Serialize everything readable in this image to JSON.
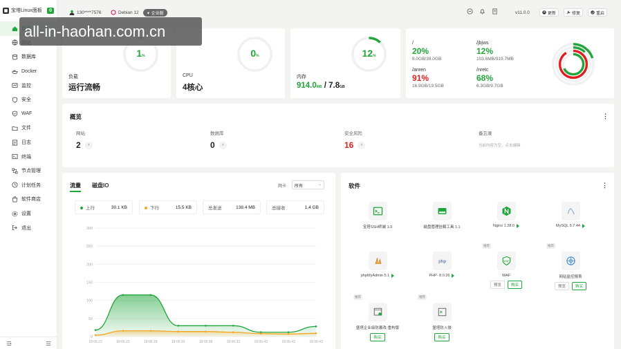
{
  "brand": {
    "name": "宝塔Linux面板",
    "badge": "0"
  },
  "nav": [
    {
      "label": "首页",
      "icon": "home-icon"
    },
    {
      "label": "网站",
      "icon": "globe-icon"
    },
    {
      "label": "数据库",
      "icon": "database-icon"
    },
    {
      "label": "Docker",
      "icon": "docker-icon"
    },
    {
      "label": "监控",
      "icon": "monitor-icon"
    },
    {
      "label": "安全",
      "icon": "shield-icon"
    },
    {
      "label": "WAF",
      "icon": "waf-icon"
    },
    {
      "label": "文件",
      "icon": "folder-icon"
    },
    {
      "label": "日志",
      "icon": "log-icon"
    },
    {
      "label": "终端",
      "icon": "terminal-icon"
    },
    {
      "label": "节点管理",
      "icon": "node-icon"
    },
    {
      "label": "计划任务",
      "icon": "clock-icon"
    },
    {
      "label": "软件商店",
      "icon": "store-icon"
    },
    {
      "label": "设置",
      "icon": "gear-icon"
    },
    {
      "label": "退出",
      "icon": "logout-icon"
    }
  ],
  "header": {
    "user": "130****7576",
    "os": "Debian 12",
    "edition": "企业版",
    "version": "v11.0.0",
    "update": "更新",
    "repair": "修复",
    "restart": "重启"
  },
  "stats": {
    "load": {
      "percent": 1,
      "unit": "%",
      "label": "负载",
      "value": "运行流畅"
    },
    "cpu": {
      "percent": 0,
      "unit": "%",
      "label": "CPU",
      "value": "4核心"
    },
    "memory": {
      "percent": 12,
      "unit": "%",
      "label": "内存",
      "used": "914.0",
      "used_unit": "MB",
      "sep": " / ",
      "total": "7.8",
      "total_unit": "GB"
    }
  },
  "disks": [
    {
      "path": "/",
      "percent": "20%",
      "size": "8.0GB/39.0GB",
      "status": "ok",
      "fraction": 0.2
    },
    {
      "path": "/jbjws",
      "percent": "12%",
      "size": "103.6MB/919.7MB",
      "status": "ok",
      "fraction": 0.12
    },
    {
      "path": "/anren",
      "percent": "91%",
      "size": "16.9GB/19.5GB",
      "status": "danger",
      "fraction": 0.91
    },
    {
      "path": "/nretc",
      "percent": "68%",
      "size": "6.3GB/9.7GB",
      "status": "ok",
      "fraction": 0.68
    }
  ],
  "overview": {
    "title": "概览",
    "items": [
      {
        "label": "网站",
        "value": "2"
      },
      {
        "label": "数据库",
        "value": "0"
      },
      {
        "label": "安全风险",
        "value": "16"
      },
      {
        "label": "备忘录",
        "note": "当前内容为空，点击编辑"
      }
    ]
  },
  "traffic": {
    "tab_flow": "流量",
    "tab_disk": "磁盘IO",
    "nic_label": "网卡",
    "nic_value": "所有",
    "up_label": "上行",
    "up_value": "30.1 KB",
    "down_label": "下行",
    "down_value": "15.5 KB",
    "sent_label": "总发送",
    "sent_value": "138.4 MB",
    "recv_label": "总接收",
    "recv_value": "1.4 GB"
  },
  "chart_data": {
    "type": "area",
    "ylim": [
      0,
      300
    ],
    "yticks": [
      0,
      50,
      100,
      150,
      200,
      250,
      300
    ],
    "categories": [
      "18:06:23",
      "18:06:23",
      "18:06:28",
      "18:06:26",
      "18:06:38",
      "18:06:33",
      "18:06:43",
      "18:06:43",
      "18:06:43"
    ],
    "series": [
      {
        "name": "上行",
        "color": "#20a53a",
        "values": [
          18,
          115,
          115,
          30,
          30,
          30,
          12,
          12,
          28
        ]
      },
      {
        "name": "下行",
        "color": "#f5a623",
        "values": [
          4,
          16,
          16,
          14,
          14,
          12,
          8,
          7,
          9
        ]
      }
    ]
  },
  "software": {
    "title": "软件",
    "items": [
      {
        "name": "宝塔SSH终端 1.0",
        "icon": "ssh-terminal-icon",
        "play": false
      },
      {
        "name": "磁盘管理挂载工具 1.1",
        "icon": "disk-mount-icon",
        "play": false
      },
      {
        "name": "Nginx 1.28.0",
        "icon": "nginx-icon",
        "play": true
      },
      {
        "name": "MySQL 5.7.44",
        "icon": "mysql-icon",
        "play": true
      },
      {
        "name": "phpMyAdmin 5.1",
        "icon": "phpmyadmin-icon",
        "play": true
      },
      {
        "name": "PHP- 8.0.26",
        "icon": "php-icon",
        "play": true
      },
      {
        "name": "WAF",
        "icon": "waf-shield-icon",
        "tag": "推荐",
        "btn1": "预览",
        "btn2": "购买"
      },
      {
        "name": "网站监控报表",
        "icon": "site-monitor-icon",
        "tag": "推荐",
        "btn1": "预览",
        "btn2": "购买"
      },
      {
        "name": "堡塔企业级防篡改-重构版",
        "icon": "tamper-icon",
        "tag": "推荐",
        "btn2": "购买"
      },
      {
        "name": "堡塔防入侵",
        "icon": "intrusion-icon",
        "tag": "推荐",
        "btn2": "购买"
      }
    ]
  },
  "watermark": "all-in-haohan.com.cn"
}
